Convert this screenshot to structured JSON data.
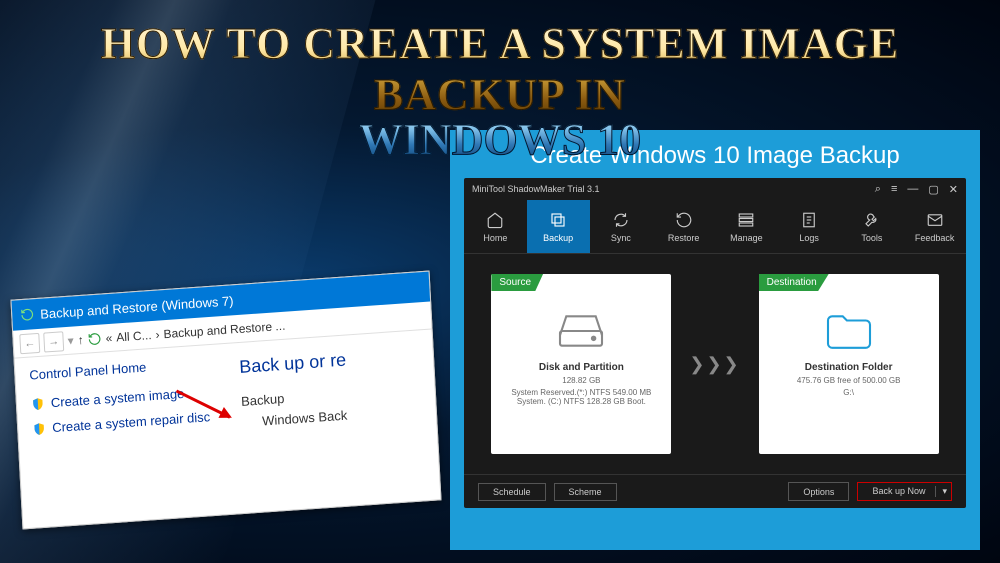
{
  "title": {
    "line1": "HOW TO CREATE A SYSTEM IMAGE BACKUP IN",
    "line2": "WINDOWS 10"
  },
  "control_panel": {
    "window_title": "Backup and Restore (Windows 7)",
    "breadcrumb_sep": "«",
    "breadcrumb_1": "All C...",
    "breadcrumb_arrow": "›",
    "breadcrumb_2": "Backup and Restore ...",
    "home_label": "Control Panel Home",
    "link_system_image": "Create a system image",
    "link_repair_disc": "Create a system repair disc",
    "heading": "Back up or re",
    "backup_label": "Backup",
    "backup_status": "Windows Back"
  },
  "minitool": {
    "frame_heading": "Create Windows 10 Image Backup",
    "app_title": "MiniTool ShadowMaker Trial 3.1",
    "toolbar": [
      {
        "label": "Home"
      },
      {
        "label": "Backup"
      },
      {
        "label": "Sync"
      },
      {
        "label": "Restore"
      },
      {
        "label": "Manage"
      },
      {
        "label": "Logs"
      },
      {
        "label": "Tools"
      },
      {
        "label": "Feedback"
      }
    ],
    "source": {
      "head": "Source",
      "title": "Disk and Partition",
      "size": "128.82 GB",
      "detail": "System Reserved.(*:) NTFS 549.00 MB System. (C:) NTFS 128.28 GB Boot."
    },
    "destination": {
      "head": "Destination",
      "title": "Destination Folder",
      "size": "475.76 GB free of 500.00 GB",
      "detail": "G:\\"
    },
    "footer": {
      "schedule": "Schedule",
      "scheme": "Scheme",
      "options": "Options",
      "backup_now": "Back up Now"
    }
  }
}
